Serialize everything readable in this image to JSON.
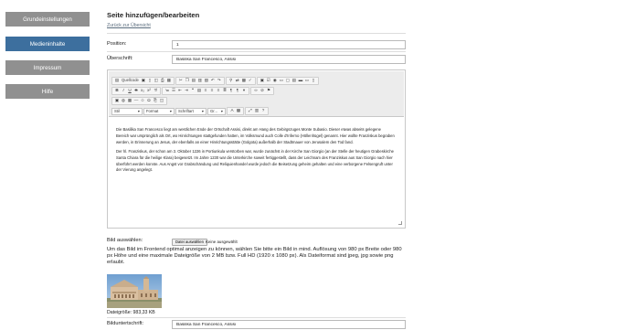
{
  "sidebar": {
    "items": [
      {
        "label": "Grundeinstellungen",
        "active": false
      },
      {
        "label": "Medieninhalte",
        "active": true
      },
      {
        "label": "Impressum",
        "active": false
      },
      {
        "label": "Hilfe",
        "active": false
      }
    ]
  },
  "page": {
    "title": "Seite hinzufügen/bearbeiten",
    "back_link": "Zurück zur Übersicht"
  },
  "form": {
    "position_label": "Position:",
    "position_value": "1",
    "heading_label": "Überschrift:",
    "heading_value": "Basilika San Francesco, Assisi",
    "image_select_label": "Bild auswählen:",
    "file_button": "Datei auswählen",
    "file_status": "Keine ausgewählt",
    "help_text": "Um das Bild im Frontend optimal anzeigen zu können, wählen Sie bitte ein Bild in mind. Auflösung von 980 px Breite oder 980 px Höhe und eine maximale Dateigröße von 2 MB bzw. Full HD (1920 x 1080 px). Als Dateiformat sind jpeg, jpg sowie png erlaubt.",
    "file_size": "Dateigröße: 983,33 KB",
    "caption_label": "Bilduntertschrift:",
    "caption_value": "Basilika San Francesco, Assisi"
  },
  "editor": {
    "source_button": "Quellcode",
    "selects": {
      "styles": "Stil",
      "format": "Format",
      "font": "Schriftart",
      "size": "Gr..."
    },
    "paragraphs": [
      "Die Basilika San Francesco liegt am westlichen Ende der Ortschaft Assisi, direkt am Hang des Gebirgszuges Monte Subasio. Dieser etwas abseits gelegene Bereich war ursprünglich als Ort, wo Hinrichtungen stattgefunden hatten, im Volksmund auch Colle d'Inferno (Höllenhügel) genannt. Hier wollte Franziskus begraben werden, in Erinnerung an Jesus, der ebenfalls an einer Hinrichtungsstätte (Golgota) außerhalb der Stadtmauer von Jerusalem den Tod fand.",
      "Der hl. Franziskus, der schon am 3. Oktober 1226 in Portiunkula verstorben war, wurde zunächst in der Kirche San Giorgio (an der Stelle der heutigen Grabeskirche Santa Chiara für die heilige Klara) beigesetzt. Im Jahre 1230 war die Unterkirche soweit fertiggestellt, dass der Leichnam des Franziskus aus San Giorgio nach hier überführt werden konnte. Aus Angst vor Grabschändung und Reliquienhandel wurde jedoch die Beisetzung geheim gehalten und eine verborgene Felsengruft unter der Vierung angelegt."
    ]
  },
  "colors": {
    "sidebar_active": "#3d6f9e",
    "sidebar_inactive": "#909090",
    "link": "#5a6c7d"
  }
}
